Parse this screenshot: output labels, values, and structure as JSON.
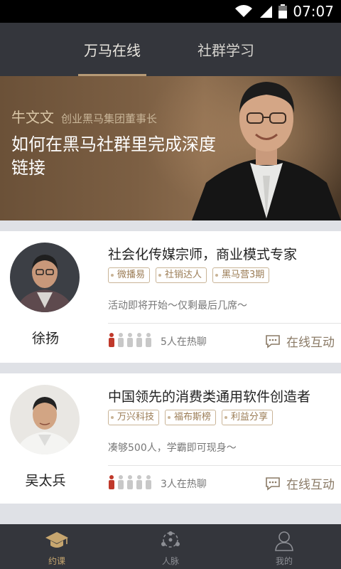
{
  "status_bar": {
    "time": "07:07"
  },
  "top_tabs": [
    {
      "label": "万马在线",
      "active": true
    },
    {
      "label": "社群学习",
      "active": false
    }
  ],
  "banner": {
    "name": "牛文文",
    "role": "创业黑马集团董事长",
    "headline": "如何在黑马社群里完成深度链接"
  },
  "courses": [
    {
      "mentor": "徐扬",
      "title": "社会化传媒宗师，商业模式专家",
      "tags": [
        "微播易",
        "社销达人",
        "黑马营3期"
      ],
      "status": "活动即将开始～仅剩最后几席～",
      "chat_count": "5人在热聊",
      "interact_label": "在线互动"
    },
    {
      "mentor": "吴太兵",
      "title": "中国领先的消费类通用软件创造者",
      "tags": [
        "万兴科技",
        "福布斯榜",
        "利益分享"
      ],
      "status": "凑够500人，学霸即可现身～",
      "chat_count": "3人在热聊",
      "interact_label": "在线互动"
    }
  ],
  "bottom_nav": [
    {
      "label": "约课",
      "icon": "graduation-cap-icon",
      "active": true
    },
    {
      "label": "人脉",
      "icon": "network-icon",
      "active": false
    },
    {
      "label": "我的",
      "icon": "user-icon",
      "active": false
    }
  ],
  "colors": {
    "accent": "#b69a76",
    "nav_bg": "#34363c",
    "active_person": "#c0392b"
  }
}
